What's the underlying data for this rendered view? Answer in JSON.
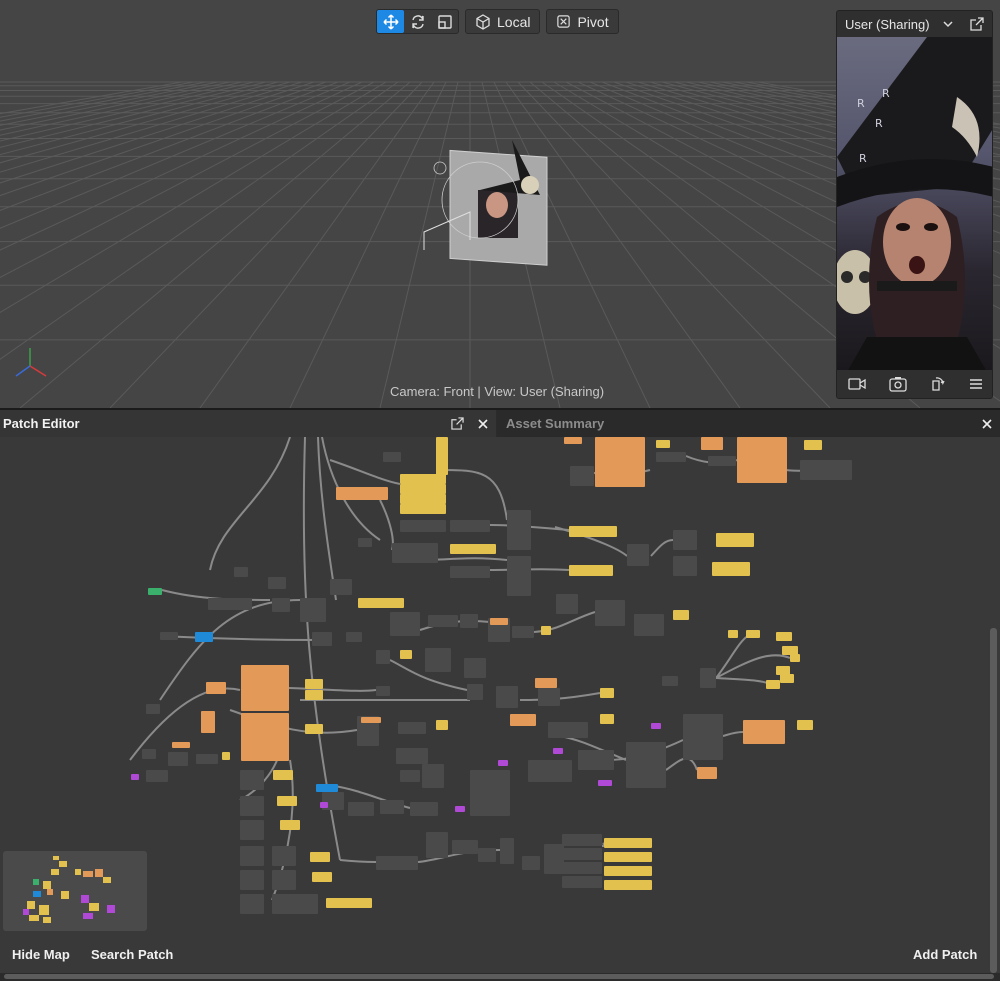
{
  "viewport": {
    "toolbar": {
      "local_label": "Local",
      "pivot_label": "Pivot"
    },
    "camera_label": "Camera: Front | View: User (Sharing)"
  },
  "preview": {
    "title": "User (Sharing)"
  },
  "patch_editor": {
    "title": "Patch Editor",
    "asset_tab_title": "Asset Summary",
    "hide_map_label": "Hide Map",
    "search_patch_label": "Search Patch",
    "add_patch_label": "Add Patch"
  },
  "colors": {
    "accent_blue": "#1e88e5",
    "patch_yellow": "#e3c14e",
    "patch_orange": "#e39a58",
    "patch_gray": "#4a4a4a",
    "patch_purple": "#b04ad6",
    "patch_green": "#3bb06c",
    "patch_blue": "#1f8ad8"
  }
}
